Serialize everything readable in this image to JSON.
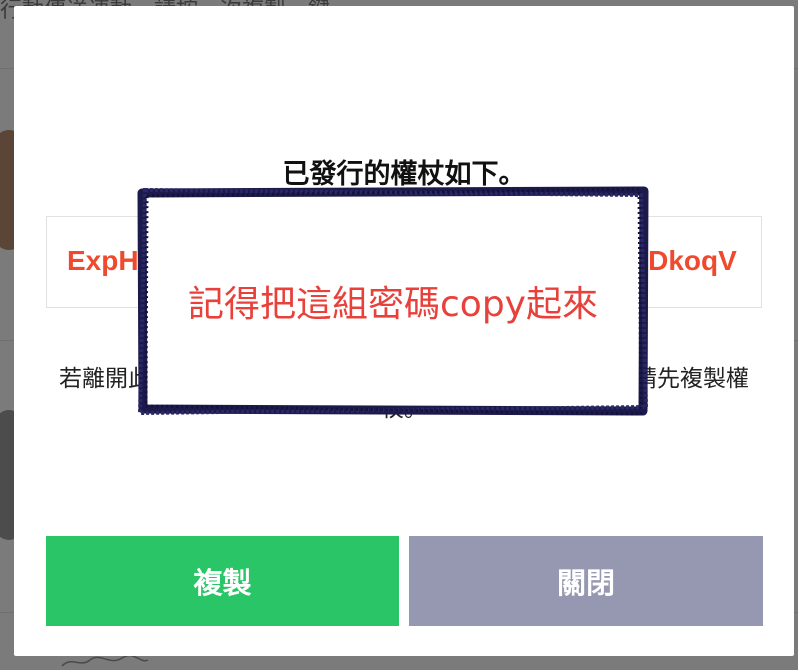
{
  "background": {
    "top_line": "行動傳送連動。請按一次複製一鍵。"
  },
  "modal": {
    "title": "已發行的權杖如下。",
    "token_start": "ExpH",
    "token_end": "LDkoqV",
    "warning": "若離開此頁面，將無法再次確認權杖。離開此頁面之前，請先複製權杖。",
    "copy_button": "複製",
    "close_button": "關閉"
  },
  "annotation": {
    "text": "記得把這組密碼copy起來"
  },
  "colors": {
    "token": "#ef4a2e",
    "copy": "#2ac567",
    "close": "#9598b0",
    "annotation_text": "#e8413b",
    "annotation_border": "#1c1a4a"
  }
}
